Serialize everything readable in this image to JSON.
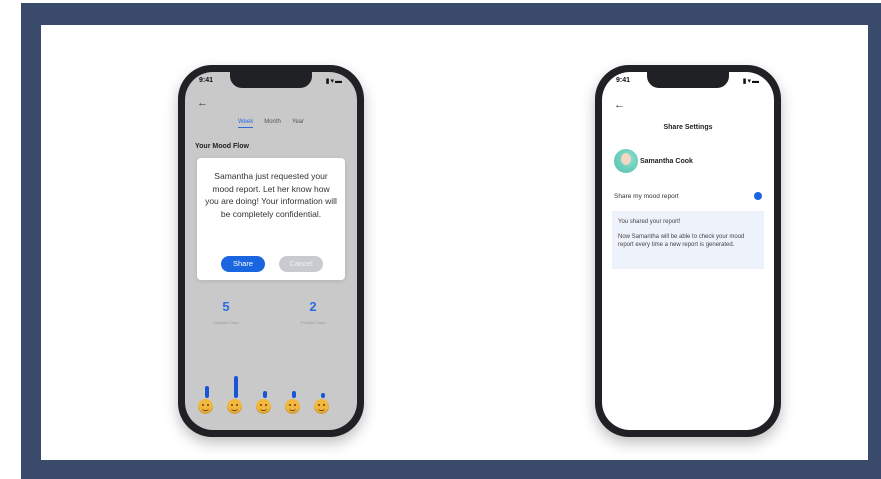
{
  "status_bar": {
    "time": "9:41",
    "icons": "▮▾▬"
  },
  "phone1": {
    "tabs": [
      {
        "label": "Week",
        "active": true
      },
      {
        "label": "Month",
        "active": false
      },
      {
        "label": "Year",
        "active": false
      }
    ],
    "section_title": "Your Mood Flow",
    "modal": {
      "message": "Samantha just requested your mood report. Let her know how you are doing! Your information will be completely confidential.",
      "share_label": "Share",
      "cancel_label": "Cancel"
    },
    "stats": [
      {
        "value": "5",
        "label": "Negative Days"
      },
      {
        "value": "2",
        "label": "Positive Days"
      }
    ],
    "mood_bars": [
      0.35,
      0.65,
      0.2,
      0.2,
      0.15
    ],
    "emoji_icons": [
      "tired-face-icon",
      "crying-face-icon",
      "neutral-face-icon",
      "grinning-face-icon",
      "smiling-face-icon"
    ]
  },
  "phone2": {
    "title": "Share Settings",
    "user_name": "Samantha Cook",
    "share_label": "Share my mood report",
    "share_enabled": true,
    "info_line1": "You shared your report!",
    "info_line2": "Now Samantha will be able to check your mood report every time a new report is generated."
  },
  "colors": {
    "frame": "#3a4a6b",
    "accent": "#1a66e0",
    "bar": "#1a55d6"
  }
}
